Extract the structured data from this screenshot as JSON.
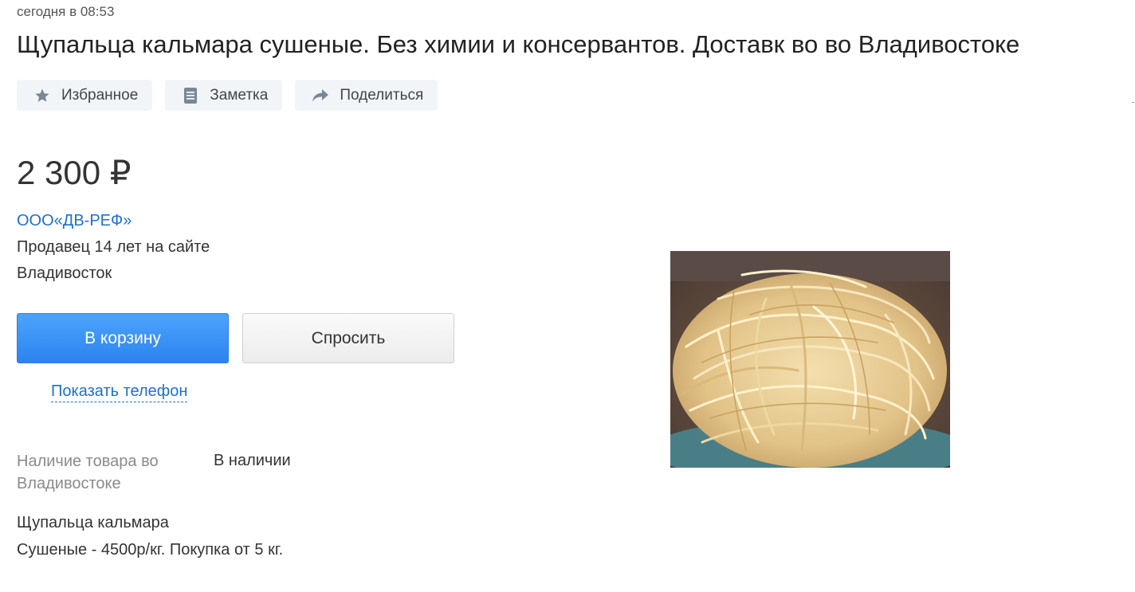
{
  "listing": {
    "timestamp": "сегодня в 08:53",
    "title": "Щупальца кальмара сушеные. Без химии и консервантов. Доставк во во Владивостоке",
    "price": "2 300 ₽"
  },
  "actions": {
    "favorite": {
      "label": "Избранное",
      "icon": "star-icon"
    },
    "note": {
      "label": "Заметка",
      "icon": "note-icon"
    },
    "share": {
      "label": "Поделиться",
      "icon": "share-arrow-icon"
    }
  },
  "seller": {
    "name": "ООО«ДВ-РЕФ»",
    "age": "Продавец 14 лет на сайте",
    "city": "Владивосток"
  },
  "buttons": {
    "cart": "В корзину",
    "ask": "Спросить",
    "show_phone": "Показать телефон"
  },
  "params": {
    "availability_label": "Наличие товара во Владивостоке",
    "availability_value": "В наличии"
  },
  "description": {
    "line1": "Щупальца кальмара",
    "line2": "Сушеные - 4500р/кг. Покупка от 5 кг."
  },
  "photo": {
    "subject": "dried squid tentacles on a plate"
  },
  "colors": {
    "accent_link": "#1f6fd0",
    "primary_button": "#2b84f0",
    "action_button_bg": "#f2f5f8",
    "icon_gray": "#7a8796"
  }
}
